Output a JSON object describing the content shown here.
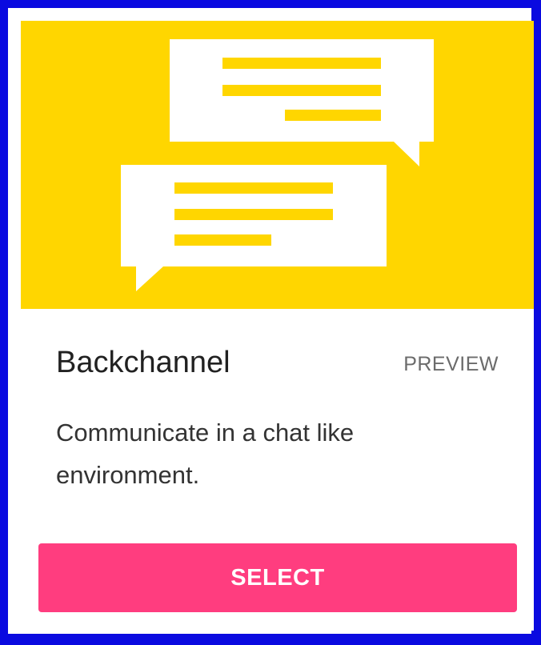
{
  "card": {
    "title": "Backchannel",
    "preview_label": "PREVIEW",
    "description": "Communicate in a chat like environment.",
    "select_label": "SELECT",
    "hero_icon": "chat-bubbles-icon"
  },
  "colors": {
    "page_border": "#0a0ae0",
    "hero_background": "#ffd600",
    "bubble": "#ffffff",
    "bubble_lines": "#ffd600",
    "button_background": "#ff3d7f",
    "button_text": "#ffffff",
    "title_text": "#212121",
    "preview_text": "#6b6b6b"
  }
}
